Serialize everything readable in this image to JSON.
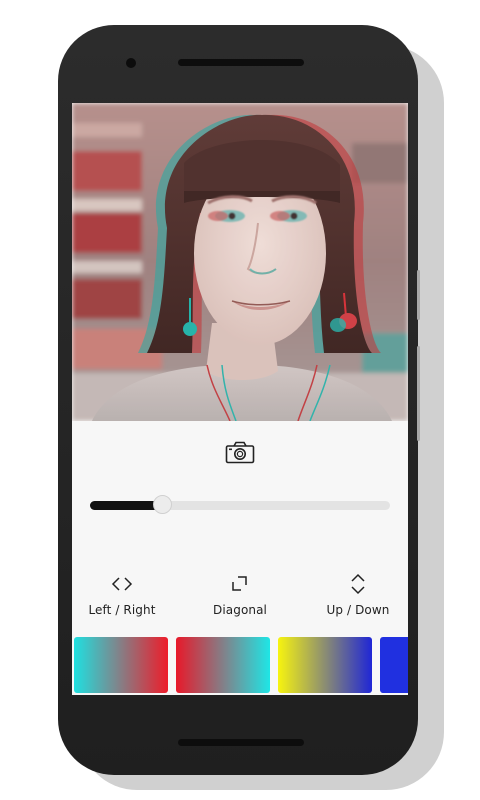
{
  "toolbar": {
    "camera_icon": "camera-icon"
  },
  "effect": {
    "intensity_fraction": 0.24
  },
  "directions": [
    {
      "label": "Left / Right",
      "icon": "left-right-arrows-icon"
    },
    {
      "label": "Diagonal",
      "icon": "diagonal-corner-icon"
    },
    {
      "label": "Up / Down",
      "icon": "up-down-arrows-icon"
    }
  ],
  "presets": [
    {
      "from": "#1fe0e0",
      "to": "#ee1c2a"
    },
    {
      "from": "#e8192a",
      "to": "#1ee6e6"
    },
    {
      "from": "#f7f40f",
      "to": "#1f26d6"
    },
    {
      "from": "#2030e0",
      "to": "#2030e0"
    }
  ]
}
